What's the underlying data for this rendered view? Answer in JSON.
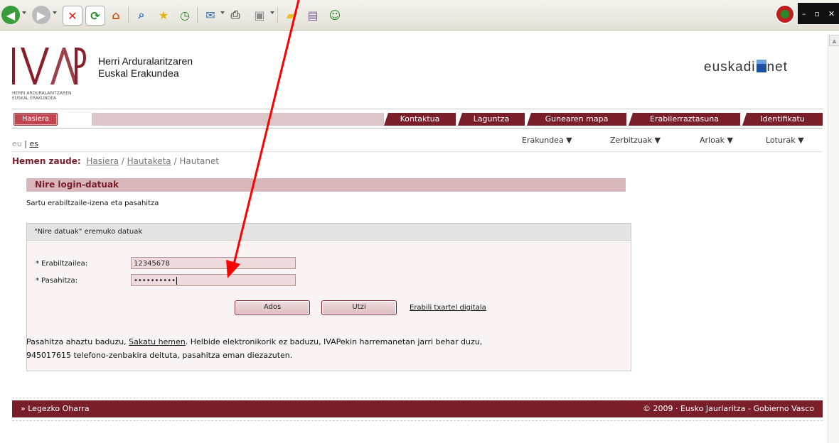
{
  "browser": {
    "toolbar_icons": [
      "back-icon",
      "forward-icon",
      "stop-icon",
      "refresh-icon",
      "home-icon",
      "search-icon",
      "favorites-icon",
      "history-icon",
      "mail-icon",
      "print-icon",
      "edit-icon",
      "notes-icon",
      "research-icon",
      "messenger-icon"
    ],
    "window_controls": [
      "–",
      "▫",
      "✕"
    ]
  },
  "header": {
    "logo_text": "IVAP",
    "logo_small_line1": "HERRI ARDURALARITZAREN",
    "logo_small_line2": "EUSKAL ERAKUNDEA",
    "org_name_line1": "Herri Arduralaritzaren",
    "org_name_line2": "Euskal Erakundea",
    "euskadi_left": "euskadi",
    "euskadi_right": "net"
  },
  "nav": {
    "home": "Hasiera",
    "tabs": [
      "Kontaktua",
      "Laguntza",
      "Gunearen mapa",
      "Erabilerraztasuna",
      "Identifikatu"
    ]
  },
  "lang": {
    "eu": "eu",
    "sep": "|",
    "es": "es"
  },
  "menus": [
    "Erakundea ▼",
    "Zerbitzuak ▼",
    "Arloak ▼",
    "Loturak ▼"
  ],
  "breadcrumb": {
    "label": "Hemen zaude:",
    "items": [
      "Hasiera",
      "Hautaketa",
      "Hautanet"
    ],
    "sep": " / "
  },
  "panel": {
    "title": "Nire login-datuak",
    "subtitle": "Sartu erabiltzaile-izena eta pasahitza"
  },
  "form": {
    "header": "\"Nire datuak\" eremuko datuak",
    "user_label": "* Erabiltzailea:",
    "user_value": "12345678",
    "pass_label": "* Pasahitza:",
    "pass_value": "••••••••••",
    "ok_button": "Ados",
    "cancel_button": "Utzi",
    "digital_link": "Erabili txartel digitala",
    "help_pre": "Pasahitza ahaztu baduzu, ",
    "help_link": "Sakatu hemen",
    "help_post": ". Helbide elektronikorik ez baduzu, IVAPekin harremanetan jarri behar duzu,",
    "help_line2": "945017615 telefono-zenbakira deituta, pasahitza eman diezazuten."
  },
  "footer": {
    "legal": "» Legezko Oharra",
    "copyright": "© 2009 · Eusko Jaurlaritza - Gobierno Vasco"
  },
  "colors": {
    "brand": "#7a1e2a",
    "annotation_arrow": "#ff0000"
  }
}
